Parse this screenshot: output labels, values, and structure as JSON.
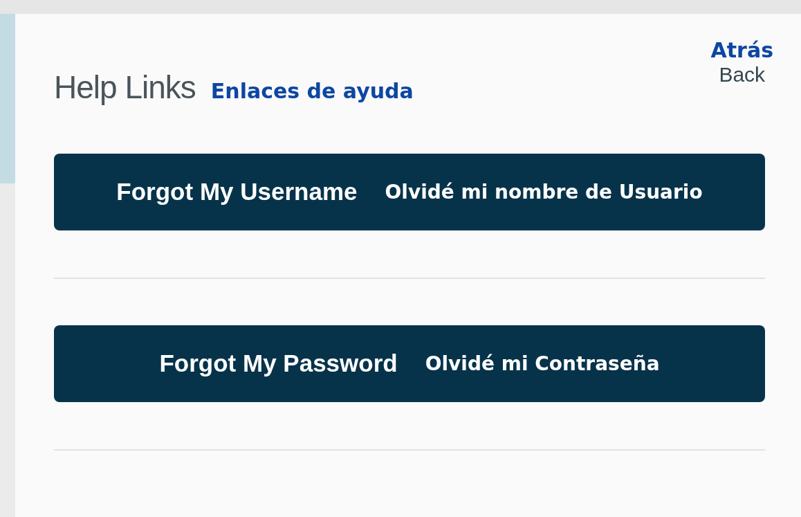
{
  "header": {
    "title": "Help Links",
    "title_translation": "Enlaces de ayuda"
  },
  "back_link": {
    "translation": "Atrás",
    "label": "Back"
  },
  "buttons": [
    {
      "label": "Forgot My Username",
      "translation": "Olvidé mi nombre de Usuario"
    },
    {
      "label": "Forgot My Password",
      "translation": "Olvidé mi Contraseña"
    }
  ]
}
